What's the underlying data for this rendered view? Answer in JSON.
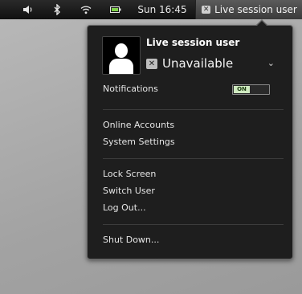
{
  "topbar": {
    "icons": [
      "volume-icon",
      "bluetooth-icon",
      "wifi-icon",
      "battery-icon"
    ],
    "clock": "Sun 16:45",
    "user_menu_label": "Live session user",
    "status_badge_glyph": "✕"
  },
  "user_menu": {
    "username": "Live session user",
    "status": "Unavailable",
    "status_badge_glyph": "✕",
    "status_chevron": "⌄",
    "notifications_label": "Notifications",
    "notifications_toggle": "ON",
    "items_group1": [
      "Online Accounts",
      "System Settings"
    ],
    "items_group2": [
      "Lock Screen",
      "Switch User",
      "Log Out..."
    ],
    "items_group3": [
      "Shut Down..."
    ]
  },
  "colors": {
    "panel_bg": "#1e1e1e",
    "topbar_bg": "#101010",
    "toggle_on": "#cfeac0",
    "battery_accent": "#7fd14a"
  }
}
